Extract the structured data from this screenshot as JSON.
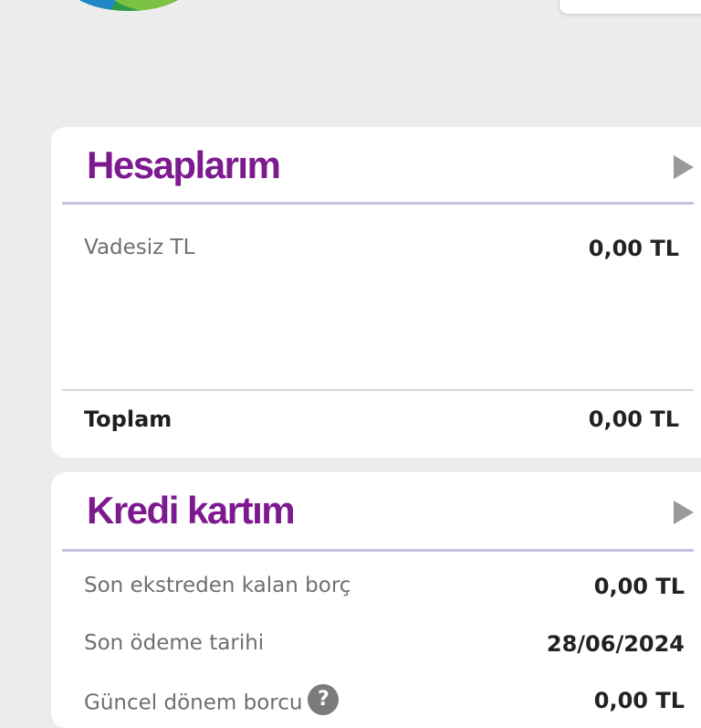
{
  "header": {
    "logo_icon": "bank-logo-icon"
  },
  "accounts_card": {
    "title": "Hesaplarım",
    "arrow_icon": "play-right-icon",
    "rows": [
      {
        "label": "Vadesiz TL",
        "value": "0,00 TL"
      }
    ],
    "total_label": "Toplam",
    "total_value": "0,00 TL"
  },
  "credit_card": {
    "title": "Kredi kartım",
    "arrow_icon": "play-right-icon",
    "rows": [
      {
        "label": "Son ekstreden kalan borç",
        "value": "0,00 TL"
      },
      {
        "label": "Son ödeme tarihi",
        "value": "28/06/2024"
      },
      {
        "label": "Güncel dönem borcu",
        "value": "0,00 TL",
        "help_icon": "question-circle-icon",
        "help_text": "?"
      }
    ]
  },
  "colors": {
    "brand_purple": "#7d1a8f",
    "divider_lavender": "#c8c1e0",
    "page_background": "#ececec"
  }
}
